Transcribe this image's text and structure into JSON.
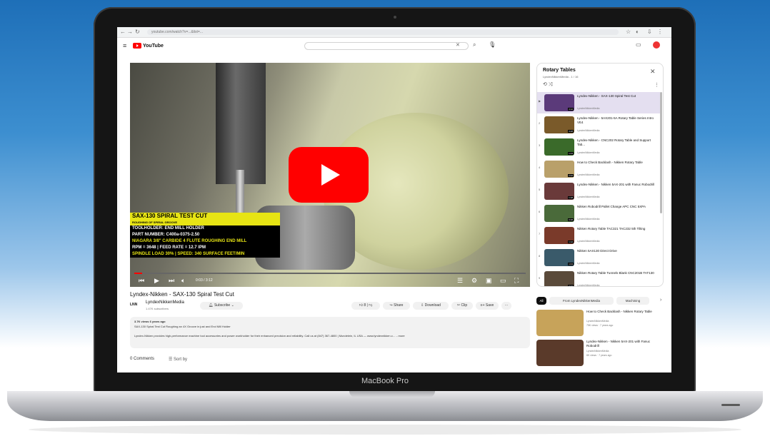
{
  "laptop": {
    "brand_label": "MacBook Pro"
  },
  "browser": {
    "url": "youtube.com/watch?v=...&list=...",
    "icons": [
      "back-icon",
      "forward-icon",
      "reload-icon"
    ]
  },
  "youtube": {
    "logo_text": "YouTube",
    "search_placeholder": "",
    "video": {
      "overlay": {
        "title": "SAX-130 SPIRAL TEST CUT",
        "subtitle": "ROUGHING OF SPIRAL GROOVE",
        "toolholder": "TOOLHOLDER:   END MILL HOLDER",
        "part_number": "PART NUMBER:   C400a-0375-2.50",
        "tool": "NIAGARA 3/8\" CARBIDE 4 FLUTE ROUGHING END MILL",
        "rpm": "RPM = 3648   |   FEED RATE = 12.7 IPM",
        "load": "SPINDLE LOAD 30%   |   SPEED: 340 SURFACE FEET/MIN"
      },
      "time": "0:03 / 3:12",
      "progress": 0.02,
      "title": "Lyndex-Nikken - SAX-130 Spiral Test Cut"
    },
    "channel": {
      "avatar_text": "LNN",
      "name": "LyndexNikkenMedia",
      "subs": "1.47K subscribers",
      "subscribe": "Subscribe"
    },
    "actions": {
      "like": "8",
      "share": "Share",
      "download": "Download",
      "clip": "Clip",
      "save": "Save",
      "more": "···"
    },
    "description": {
      "meta": "3.7K views  6 years ago",
      "line1": "SAX-130 Spiral Test Cut Roughing an 4X Groove in just and End Mill Holder",
      "line2": "Lyndex-Nikken provides high-performance machine tool accessories and power workholder for their enhanced precision and reliability.  Call us at (847) 367-4800 | Mundelein, IL USA — www.lyndexnikken.c...  ...more"
    },
    "comments": {
      "count": "0 Comments",
      "sort": "Sort by"
    },
    "playlist": {
      "title": "Rotary Tables",
      "subtitle": "LyndexNikkenMedia - 1 / 16",
      "items": [
        {
          "idx": "▶",
          "title": "Lyndex-Nikken - SAX-130 Spiral Test Cut",
          "channel": "LyndexNikkenMedia",
          "dur": "3:12",
          "color": "#5b3a7a"
        },
        {
          "idx": "2",
          "title": "Lyndex-Nikken - 5AX201-5A Rotary Table Series Intro VE4",
          "channel": "LyndexNikkenMedia",
          "dur": "3:48",
          "color": "#7a5a2a"
        },
        {
          "idx": "3",
          "title": "Lyndex-Nikken - CNC202 Rotary Table and Support Tab...",
          "channel": "LyndexNikkenMedia",
          "dur": "1:44",
          "color": "#3a6a2a"
        },
        {
          "idx": "4",
          "title": "How to Check Backlash - Nikken Rotary Table",
          "channel": "LyndexNikkenMedia",
          "dur": "2:22",
          "color": "#b9a06a"
        },
        {
          "idx": "5",
          "title": "Lyndex-Nikken - Nikken 5AX-201 with Fanuc Robodrill",
          "channel": "LyndexNikkenMedia",
          "dur": "1:18",
          "color": "#6a3a3a"
        },
        {
          "idx": "6",
          "title": "Nikken Robodrill Pallet Change APC CNC 5XPA",
          "channel": "LyndexNikkenMedia",
          "dur": "0:48",
          "color": "#4a6a3a"
        },
        {
          "idx": "7",
          "title": "Nikken Rotary Table TAC321 TAC232 5th Tilting",
          "channel": "LyndexNikkenMedia",
          "dur": "1:12",
          "color": "#7a3a2a"
        },
        {
          "idx": "8",
          "title": "Nikken 5AX130 Direct Drive",
          "channel": "LyndexNikkenMedia",
          "dur": "1:04",
          "color": "#3a5a6a"
        },
        {
          "idx": "9",
          "title": "Nikken Rotary Table Tunnels Blank CNC201B TAT130",
          "channel": "LyndexNikkenMedia",
          "dur": "2:10",
          "color": "#5a4a3a"
        }
      ]
    },
    "chips": [
      "All",
      "From LyndexNikkenMedia",
      "Machining"
    ],
    "recommendations": [
      {
        "title": "How to Check Backlash - Nikken Rotary Table",
        "channel": "LyndexNikkenMedia",
        "meta": "75K views · 7 years ago",
        "color": "#c7a35a"
      },
      {
        "title": "Lyndex-Nikken - Nikken 5AX-201 with Fanuc Robodrill",
        "channel": "LyndexNikkenMedia",
        "meta": "8K views · 7 years ago",
        "color": "#5a3a2a"
      }
    ],
    "colors": {
      "brand_red": "#ff0000",
      "playlist_active": "#e4dff0"
    }
  }
}
